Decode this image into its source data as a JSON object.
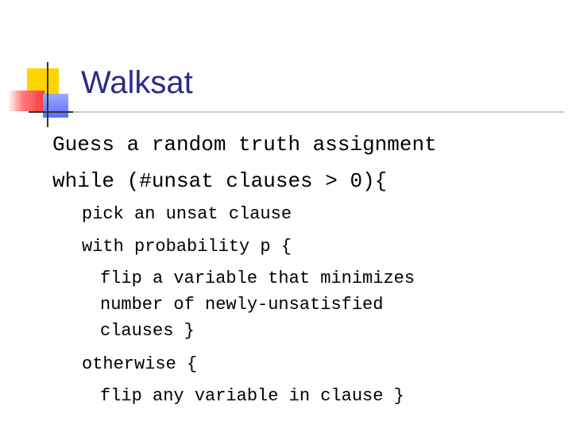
{
  "slide": {
    "title": "Walksat",
    "lines": [
      {
        "text": "Guess a random truth assignment",
        "level": 1
      },
      {
        "text": "while (#unsat clauses > 0){",
        "level": 1
      },
      {
        "text": "pick an unsat clause",
        "level": 2
      },
      {
        "text": "with probability p {",
        "level": 2
      },
      {
        "text": "flip a variable that minimizes",
        "level": 3
      },
      {
        "text": "number of newly-unsatisfied",
        "level": 3
      },
      {
        "text": "clauses }",
        "level": 3
      },
      {
        "text": "otherwise {",
        "level": 2
      },
      {
        "text": "flip any variable in clause }",
        "level": 3
      }
    ]
  },
  "colors": {
    "title": "#2b2b8a",
    "body": "#000000",
    "accent_yellow": "#ffd400",
    "accent_red": "#ff3b3b",
    "accent_blue": "#5a6eff",
    "rule": "#c9c9c9"
  }
}
